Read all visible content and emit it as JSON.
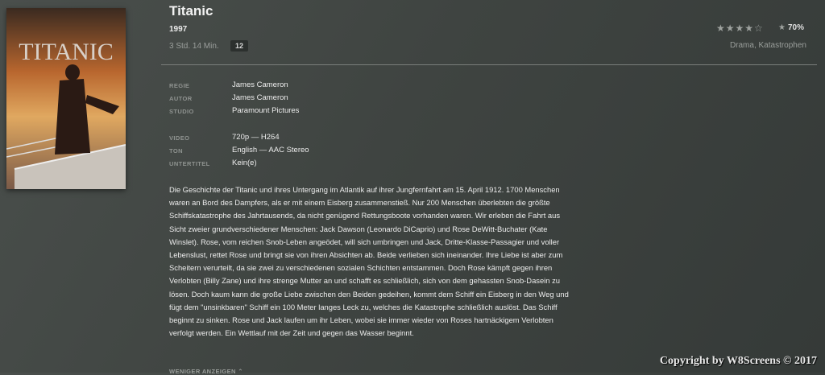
{
  "movie": {
    "title": "Titanic",
    "year": "1997",
    "duration": "3 Std. 14 Min.",
    "age_rating": "12",
    "stars": "★★★★☆",
    "score_star": "★",
    "score": "70%",
    "genres": "Drama, Katastrophen",
    "poster_title": "TITANIC"
  },
  "meta": {
    "director_label": "REGIE",
    "director": "James Cameron",
    "author_label": "AUTOR",
    "author": "James Cameron",
    "studio_label": "STUDIO",
    "studio": "Paramount Pictures",
    "video_label": "VIDEO",
    "video": "720p — H264",
    "audio_label": "TON",
    "audio": "English — AAC Stereo",
    "subtitle_label": "UNTERTITEL",
    "subtitle": "Kein(e)"
  },
  "description": "Die Geschichte der Titanic und ihres Untergang im Atlantik auf ihrer Jungfernfahrt am 15. April 1912. 1700 Menschen waren an Bord des Dampfers, als er mit einem Eisberg zusammenstieß. Nur 200 Menschen überlebten die größte Schiffskatastrophe des Jahrtausends, da nicht genügend Rettungsboote vorhanden waren. Wir erleben die Fahrt aus Sicht zweier grundverschiedener Menschen: Jack Dawson (Leonardo DiCaprio) und Rose DeWitt-Buchater (Kate Winslet). Rose, vom reichen Snob-Leben angeödet, will sich umbringen und Jack, Dritte-Klasse-Passagier und voller Lebenslust, rettet Rose und bringt sie von ihren Absichten ab. Beide verlieben sich ineinander. Ihre Liebe ist aber zum Scheitern verurteilt, da sie zwei zu verschiedenen sozialen Schichten entstammen. Doch Rose kämpft gegen ihren Verlobten (Billy Zane) und ihre strenge Mutter an und schafft es schließlich, sich von dem gehassten Snob-Dasein zu lösen. Doch kaum kann die große Liebe zwischen den Beiden gedeihen, kommt dem Schiff ein Eisberg in den Weg und fügt dem \"unsinkbaren\" Schiff ein 100 Meter langes Leck zu, welches die Katastrophe schließlich auslöst. Das Schiff beginnt zu sinken. Rose und Jack laufen um ihr Leben, wobei sie immer wieder von Roses hartnäckigem Verlobten verfolgt werden. Ein Wettlauf mit der Zeit und gegen das Wasser beginnt.",
  "less_label": "WENIGER ANZEIGEN ⌃",
  "copyright": "Copyright by W8Screens © 2017"
}
